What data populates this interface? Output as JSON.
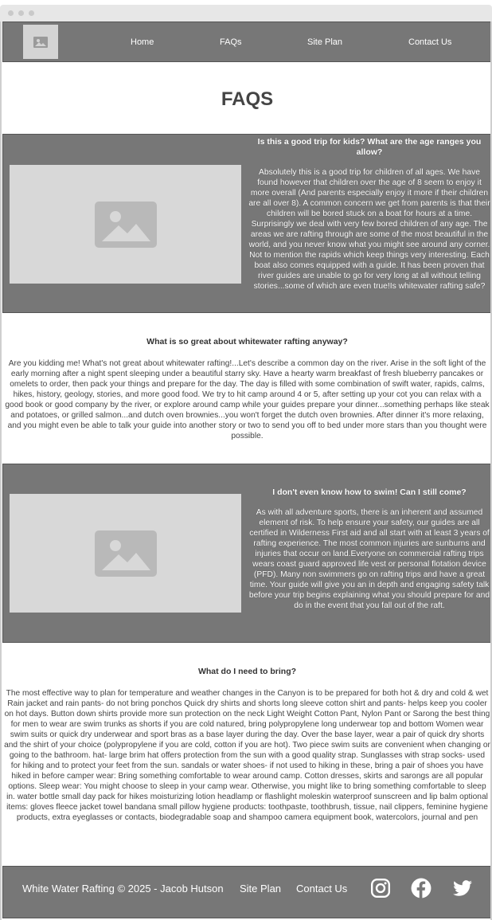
{
  "nav": {
    "links": [
      "Home",
      "FAQs",
      "Site Plan",
      "Contact Us"
    ]
  },
  "page_title": "FAQS",
  "faqs": [
    {
      "question": "Is this a good trip for kids? What are the age ranges you allow?",
      "answer": "Absolutely this is a good trip for children of all ages. We have found however that children over the age of 8 seem to enjoy it more overall (And parents especially enjoy it more if their children are all over 8). A common concern we get from parents is that their children will be bored stuck on a boat for hours at a time. Surprisingly we deal with very few bored children of any age. The areas we are rafting through are some of the most beautiful in the world, and you never know what you might see around any corner. Not to mention the rapids which keep things very interesting. Each boat also comes equipped with a guide. It has been proven that river guides are unable to go for very long at all without telling stories...some of which are even true!Is whitewater rafting safe?"
    },
    {
      "question": "What is so great about whitewater rafting anyway?",
      "answer": "Are you kidding me! What's not great about whitewater rafting!...Let's describe a common day on the river. Arise in the soft light of the early morning after a night spent sleeping under a beautiful starry sky. Have a hearty warm breakfast of fresh blueberry pancakes or omelets to order, then pack your things and prepare for the day. The day is filled with some combination of swift water, rapids, calms, hikes, history, geology, stories, and more good food. We try to hit camp around 4 or 5, after setting up your cot you can relax with a good book or good company by the river, or explore around camp while your guides prepare your dinner...something perhaps like steak and potatoes, or grilled salmon...and dutch oven brownies...you won't forget the dutch oven brownies. After dinner it's more relaxing, and you might even be able to talk your guide into another story or two to send you off to bed under more stars than you thought were possible."
    },
    {
      "question": "I don't even know how to swim! Can I still come?",
      "answer": "As with all adventure sports, there is an inherent and assumed element of risk. To help ensure your safety, our guides are all certified in Wilderness First aid and all start with at least 3 years of rafting experience. The most common injuries are sunburns and injuries that occur on land.Everyone on commercial rafting trips wears coast guard approved life vest or personal flotation device (PFD). Many non swimmers go on rafting trips and have a great time. Your guide will give you an in depth and engaging safety talk before your trip begins explaining what you should prepare for and do in the event that you fall out of the raft."
    },
    {
      "question": "What do I need to bring?",
      "answer": "The most effective way to plan for temperature and weather changes in the Canyon is to be prepared for both hot & dry and cold & wet Rain jacket and rain pants- do not bring ponchos Quick dry shirts and shorts long sleeve cotton shirt and pants- helps keep you cooler on hot days. Button down shirts provide more sun protection on the neck Light Weight Cotton Pant, Nylon Pant or Sarong the best thing for men to wear are swim trunks as shorts if you are cold natured, bring polypropylene long underwear top and bottom Women wear swim suits or quick dry underwear and sport bras as a base layer during the day. Over the base layer, wear a pair of quick dry shorts and the shirt of your choice (polypropylene if you are cold, cotton if you are hot). Two piece swim suits are convenient when changing or going to the bathroom. hat- large brim hat offers protection from the sun with a good quality strap. Sunglasses with strap socks- used for hiking and to protect your feet from the sun. sandals or water shoes- if not used to hiking in these, bring a pair of shoes you have hiked in before camper wear: Bring something comfortable to wear around camp. Cotton dresses, skirts and sarongs are all popular options. Sleep wear: You might choose to sleep in your camp wear. Otherwise, you might like to bring something comfortable to sleep in. water bottle small day pack for hikes moisturizing lotion headlamp or flashlight moleskin waterproof sunscreen and lip balm optional items: gloves fleece jacket towel bandana small pillow hygiene products: toothpaste, toothbrush, tissue, nail clippers, feminine hygiene products, extra eyeglasses or contacts, biodegradable soap and shampoo camera equipment book, watercolors, journal and pen"
    }
  ],
  "footer": {
    "copyright": "White Water Rafting © 2025 - Jacob Hutson",
    "site_plan": "Site Plan",
    "contact_us": "Contact Us",
    "social": [
      "instagram-icon",
      "facebook-icon",
      "twitter-icon"
    ]
  },
  "colors": {
    "band": "#777777",
    "placeholder": "#d8d8d8",
    "heading": "#444444"
  }
}
